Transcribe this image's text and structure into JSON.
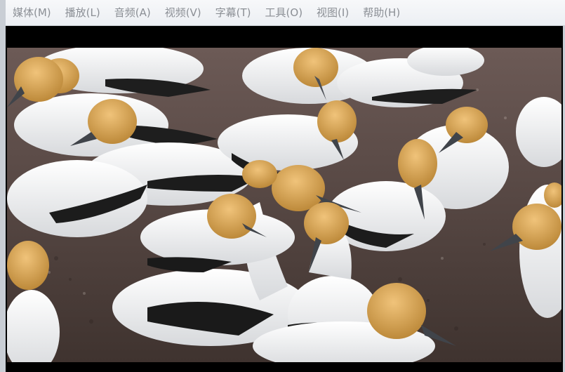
{
  "menu": {
    "items": [
      {
        "label": "媒体(M)"
      },
      {
        "label": "播放(L)"
      },
      {
        "label": "音频(A)"
      },
      {
        "label": "视频(V)"
      },
      {
        "label": "字幕(T)"
      },
      {
        "label": "工具(O)"
      },
      {
        "label": "视图(I)"
      },
      {
        "label": "帮助(H)"
      }
    ]
  },
  "colors": {
    "menubar": "#f2f4f7",
    "menu_text": "#8b8f95",
    "video_background": "#000000",
    "ground": "#5b4a45",
    "bird_body": "#f4f4f2",
    "bird_head": "#d9a95c",
    "bird_wing_dark": "#1b1b1b"
  },
  "icons": {
    "video_content": "gannet-colony-video-frame"
  }
}
